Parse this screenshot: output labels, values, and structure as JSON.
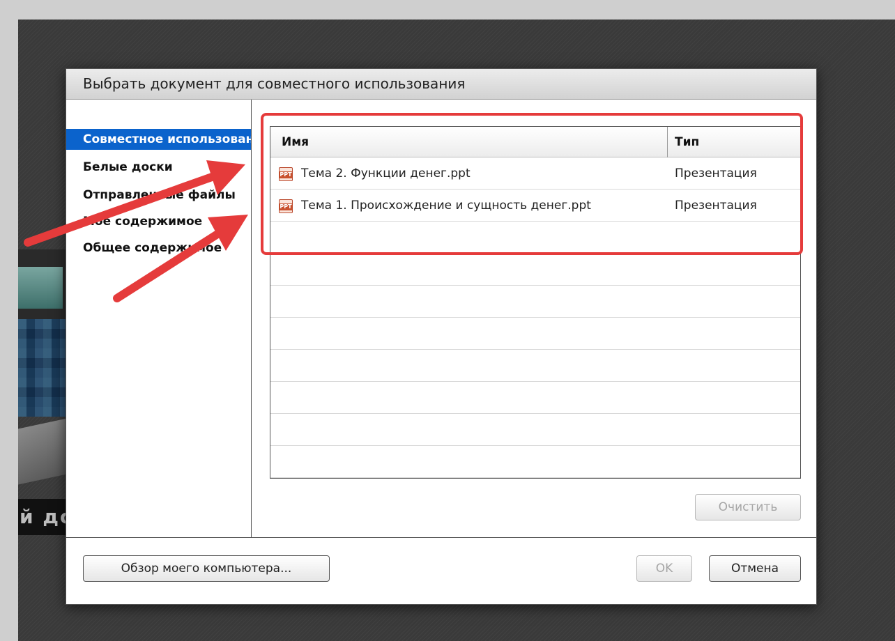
{
  "dialog": {
    "title": "Выбрать документ для совместного использования"
  },
  "sidebar": {
    "items": [
      {
        "label": "Совместное использование",
        "selected": true
      },
      {
        "label": "Белые доски",
        "selected": false
      },
      {
        "label": "Отправленные файлы",
        "selected": false
      },
      {
        "label": "Мое содержимое",
        "selected": false
      },
      {
        "label": "Общее содержимое",
        "selected": false
      }
    ]
  },
  "table": {
    "columns": {
      "name": "Имя",
      "type": "Тип"
    },
    "rows": [
      {
        "name": "Тема 2. Функции денег.ppt",
        "type": "Презентация",
        "icon": "ppt-file-icon"
      },
      {
        "name": "Тема 1. Происхождение и сущность денег.ppt",
        "type": "Презентация",
        "icon": "ppt-file-icon"
      }
    ]
  },
  "buttons": {
    "clear": "Очистить",
    "browse": "Обзор моего компьютера...",
    "ok": "OK",
    "cancel": "Отмена"
  },
  "background": {
    "banner_text": "й до"
  },
  "colors": {
    "selection": "#0b63cc",
    "annotation": "#e53b3b"
  }
}
